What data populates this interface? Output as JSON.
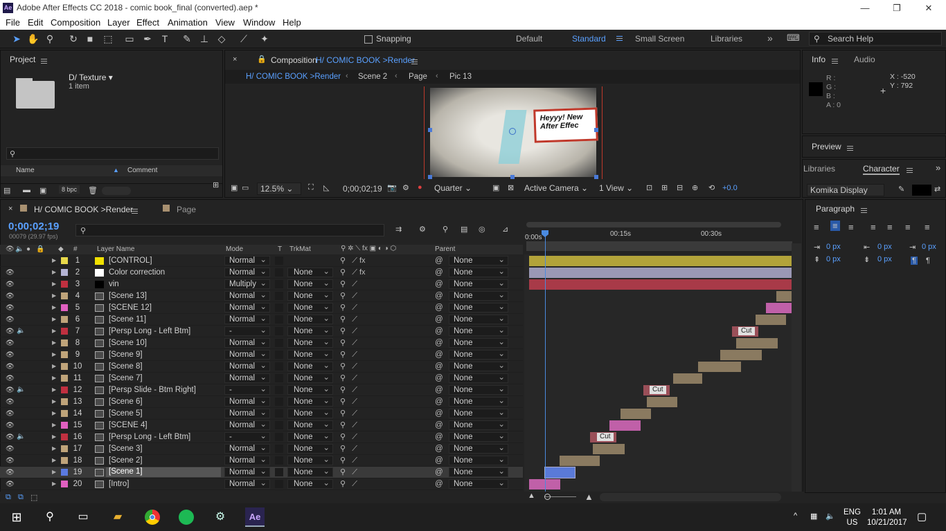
{
  "window": {
    "title": "Adobe After Effects CC 2018 - comic book_final (converted).aep *",
    "app_icon": "Ae"
  },
  "menu": [
    "File",
    "Edit",
    "Composition",
    "Layer",
    "Effect",
    "Animation",
    "View",
    "Window",
    "Help"
  ],
  "toolbar": {
    "snapping_label": "Snapping",
    "workspaces": [
      "Default",
      "Standard",
      "Small Screen",
      "Libraries"
    ],
    "active_workspace": "Standard",
    "search_placeholder": "Search Help"
  },
  "project": {
    "title": "Project",
    "folder_name": "D/ Texture",
    "item_count": "1 item",
    "col_name": "Name",
    "col_comment": "Comment",
    "bpc": "8 bpc"
  },
  "composition": {
    "tab_label": "Composition",
    "tab_comp": "H/ COMIC BOOK >Render",
    "breadcrumbs": [
      "H/ COMIC BOOK >Render",
      "Scene 2",
      "Page",
      "Pic 13"
    ],
    "preview_text_line1": "Heyyy! New",
    "preview_text_line2": "After Effec",
    "zoom": "12.5%",
    "time": "0;00;02;19",
    "resolution": "Quarter",
    "camera": "Active Camera",
    "view": "1 View",
    "exposure": "+0.0"
  },
  "info": {
    "tab_info": "Info",
    "tab_audio": "Audio",
    "r": "R :",
    "g": "G :",
    "b": "B :",
    "a": "A :  0",
    "x": "X : -520",
    "y": "Y : 792"
  },
  "preview": {
    "title": "Preview"
  },
  "character": {
    "tab_libraries": "Libraries",
    "tab_character": "Character",
    "font": "Komika Display"
  },
  "paragraph": {
    "title": "Paragraph",
    "values": [
      "0 px",
      "0 px",
      "0 px",
      "0 px",
      "0 px"
    ]
  },
  "timeline": {
    "tab": "H/ COMIC BOOK >Render",
    "tab2": "Page",
    "timecode": "0;00;02;19",
    "fps": "00079 (29.97 fps)",
    "ruler": [
      "0:00s",
      "00:15s",
      "00:30s"
    ],
    "col_layer_name": "Layer Name",
    "col_mode": "Mode",
    "col_t": "T",
    "col_trkmat": "TrkMat",
    "col_parent": "Parent",
    "col_hash": "#",
    "layers": [
      {
        "num": "1",
        "name": "[CONTROL]",
        "label": "#e8d84a",
        "icon": "solid-yellow",
        "mode": "Normal",
        "trk": "",
        "parent": "None",
        "fx": true,
        "aud": false
      },
      {
        "num": "2",
        "name": "Color correction",
        "label": "#b5b5d5",
        "icon": "solid-white",
        "mode": "Normal",
        "trk": "None",
        "parent": "None",
        "fx": true,
        "aud": false
      },
      {
        "num": "3",
        "name": "vin",
        "label": "#c03040",
        "icon": "solid-black",
        "mode": "Multiply",
        "trk": "None",
        "parent": "None",
        "fx": false,
        "aud": false
      },
      {
        "num": "4",
        "name": "[Scene 13]",
        "label": "#bfa47a",
        "icon": "comp",
        "mode": "Normal",
        "trk": "None",
        "parent": "None",
        "fx": false,
        "aud": false
      },
      {
        "num": "5",
        "name": "[SCENE 12]",
        "label": "#e060c0",
        "icon": "comp",
        "mode": "Normal",
        "trk": "None",
        "parent": "None",
        "fx": false,
        "aud": false
      },
      {
        "num": "6",
        "name": "[Scene 11]",
        "label": "#bfa47a",
        "icon": "comp",
        "mode": "Normal",
        "trk": "None",
        "parent": "None",
        "fx": false,
        "aud": false
      },
      {
        "num": "7",
        "name": "[Persp Long - Left Btm]",
        "label": "#c03040",
        "icon": "comp",
        "mode": "-",
        "trk": "None",
        "parent": "None",
        "fx": false,
        "aud": true
      },
      {
        "num": "8",
        "name": "[Scene 10]",
        "label": "#bfa47a",
        "icon": "comp",
        "mode": "Normal",
        "trk": "None",
        "parent": "None",
        "fx": false,
        "aud": false
      },
      {
        "num": "9",
        "name": "[Scene 9]",
        "label": "#bfa47a",
        "icon": "comp",
        "mode": "Normal",
        "trk": "None",
        "parent": "None",
        "fx": false,
        "aud": false
      },
      {
        "num": "10",
        "name": "[Scene 8]",
        "label": "#bfa47a",
        "icon": "comp",
        "mode": "Normal",
        "trk": "None",
        "parent": "None",
        "fx": false,
        "aud": false
      },
      {
        "num": "11",
        "name": "[Scene 7]",
        "label": "#bfa47a",
        "icon": "comp",
        "mode": "Normal",
        "trk": "None",
        "parent": "None",
        "fx": false,
        "aud": false
      },
      {
        "num": "12",
        "name": "[Persp Slide - Btm Right]",
        "label": "#c03040",
        "icon": "comp",
        "mode": "-",
        "trk": "None",
        "parent": "None",
        "fx": false,
        "aud": true
      },
      {
        "num": "13",
        "name": "[Scene 6]",
        "label": "#bfa47a",
        "icon": "comp",
        "mode": "Normal",
        "trk": "None",
        "parent": "None",
        "fx": false,
        "aud": false
      },
      {
        "num": "14",
        "name": "[Scene 5]",
        "label": "#bfa47a",
        "icon": "comp",
        "mode": "Normal",
        "trk": "None",
        "parent": "None",
        "fx": false,
        "aud": false
      },
      {
        "num": "15",
        "name": "[SCENE 4]",
        "label": "#e060c0",
        "icon": "comp",
        "mode": "Normal",
        "trk": "None",
        "parent": "None",
        "fx": false,
        "aud": false
      },
      {
        "num": "16",
        "name": "[Persp Long - Left Btm]",
        "label": "#c03040",
        "icon": "comp",
        "mode": "-",
        "trk": "None",
        "parent": "None",
        "fx": false,
        "aud": true
      },
      {
        "num": "17",
        "name": "[Scene 3]",
        "label": "#bfa47a",
        "icon": "comp",
        "mode": "Normal",
        "trk": "None",
        "parent": "None",
        "fx": false,
        "aud": false
      },
      {
        "num": "18",
        "name": "[Scene 2]",
        "label": "#bfa47a",
        "icon": "comp",
        "mode": "Normal",
        "trk": "None",
        "parent": "None",
        "fx": false,
        "aud": false
      },
      {
        "num": "19",
        "name": "[Scene 1]",
        "label": "#5a7ae0",
        "icon": "comp",
        "mode": "Normal",
        "trk": "None",
        "parent": "None",
        "fx": false,
        "aud": false,
        "selected": true
      },
      {
        "num": "20",
        "name": "[Intro]",
        "label": "#e060c0",
        "icon": "comp",
        "mode": "Normal",
        "trk": "None",
        "parent": "None",
        "fx": false,
        "aud": false
      }
    ],
    "cut_label": "Cut"
  },
  "taskbar": {
    "lang": "ENG",
    "region": "US",
    "time": "1:01 AM",
    "date": "10/21/2017"
  }
}
